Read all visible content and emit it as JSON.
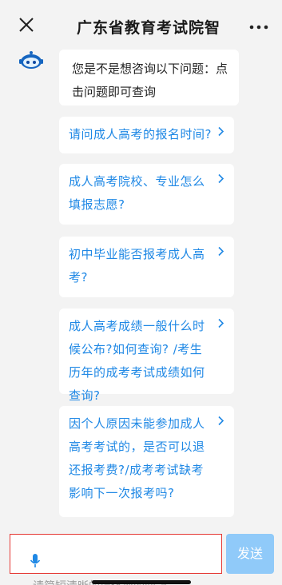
{
  "header": {
    "title": "广东省教育考试院智",
    "close_icon": "close-icon",
    "more_icon": "more-dots-icon"
  },
  "chat": {
    "greeting": "您是不是想咨询以下问题：点击问题即可查询",
    "questions": [
      {
        "text": "请问成人高考的报名时间?"
      },
      {
        "text": "成人高考院校、专业怎么填报志愿?"
      },
      {
        "text": "初中毕业能否报考成人高考?"
      },
      {
        "text": "成人高考成绩一般什么时候公布?如何查询? /考生历年的成考考试成绩如何查询?"
      },
      {
        "text": "因个人原因未能参加成人高考考试的，是否可以退还报考费?/成考考试缺考影响下一次报考吗?"
      }
    ]
  },
  "input": {
    "placeholder": "请简短清晰的描述您的问题",
    "send_label": "发送",
    "mic_icon": "microphone-icon"
  },
  "colors": {
    "link": "#1f88e5",
    "send_bg": "#90caf9",
    "highlight_border": "#e53935"
  }
}
